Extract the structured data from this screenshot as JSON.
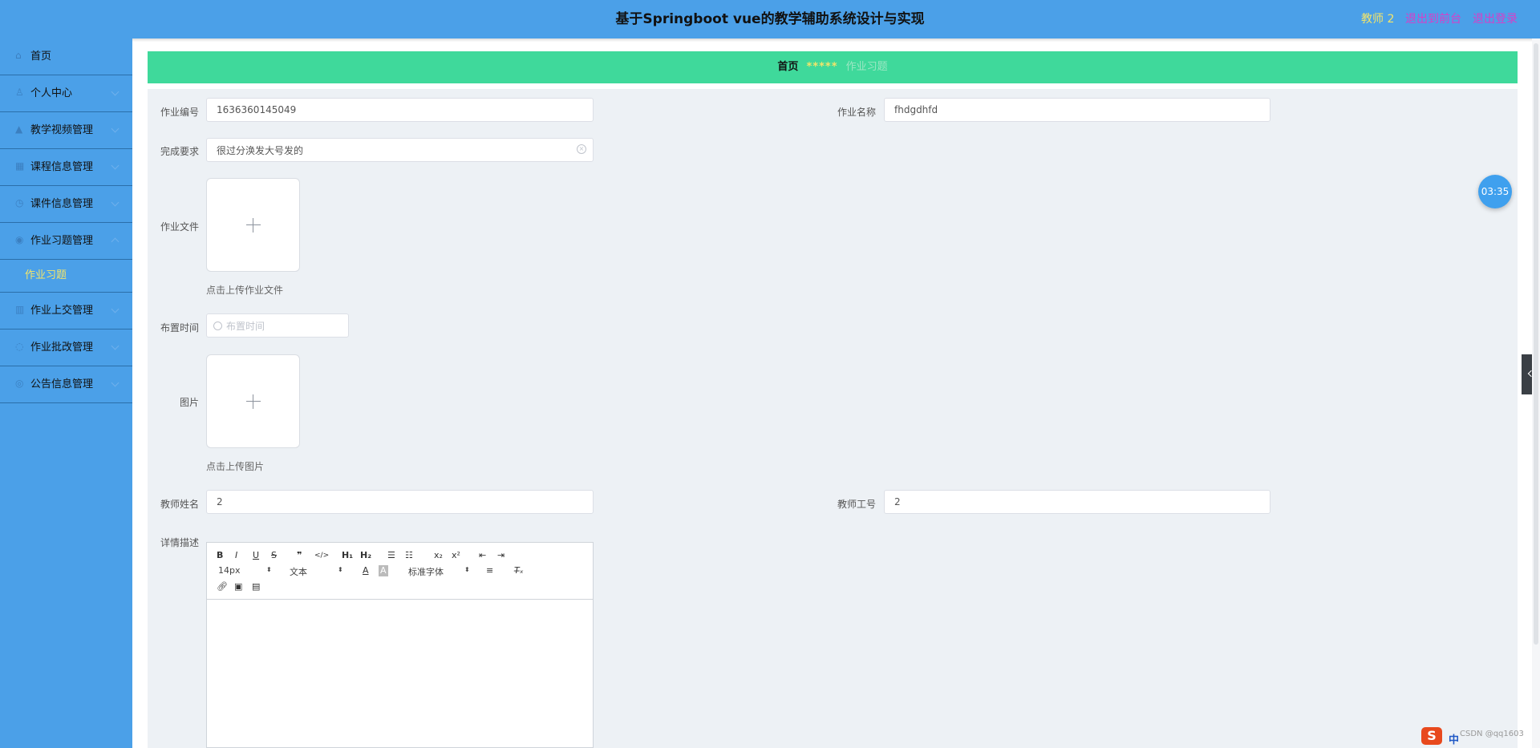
{
  "header": {
    "title": "基于Springboot vue的教学辅助系统设计与实现",
    "user": "教师 2",
    "back_to_front": "退出到前台",
    "logout": "退出登录"
  },
  "sidebar": {
    "items": [
      {
        "label": "首页",
        "icon": "home-icon"
      },
      {
        "label": "个人中心",
        "icon": "user-icon"
      },
      {
        "label": "教学视频管理",
        "icon": "video-icon"
      },
      {
        "label": "课程信息管理",
        "icon": "course-icon"
      },
      {
        "label": "课件信息管理",
        "icon": "file-icon"
      },
      {
        "label": "作业习题管理",
        "icon": "exercise-icon"
      },
      {
        "label": "作业上交管理",
        "icon": "upload-icon"
      },
      {
        "label": "作业批改管理",
        "icon": "edit-icon"
      },
      {
        "label": "公告信息管理",
        "icon": "notice-icon"
      }
    ],
    "subitem": "作业习题"
  },
  "breadcrumb": {
    "home": "首页",
    "separator": "*****",
    "current": "作业习题"
  },
  "form": {
    "homework_no_label": "作业编号",
    "homework_no_value": "1636360145049",
    "homework_name_label": "作业名称",
    "homework_name_value": "fhdgdhfd",
    "requirement_label": "完成要求",
    "requirement_value": "很过分涣发大号发的",
    "homework_file_label": "作业文件",
    "homework_file_tip": "点击上传作业文件",
    "assign_time_label": "布置时间",
    "assign_time_placeholder": "布置时间",
    "image_label": "图片",
    "image_tip": "点击上传图片",
    "teacher_name_label": "教师姓名",
    "teacher_name_value": "2",
    "teacher_no_label": "教师工号",
    "teacher_no_value": "2",
    "detail_label": "详情描述"
  },
  "editor": {
    "font_size": "14px",
    "header_type": "文本",
    "font_family": "标准字体"
  },
  "timer": "03:35",
  "watermark": "CSDN @qq1603"
}
